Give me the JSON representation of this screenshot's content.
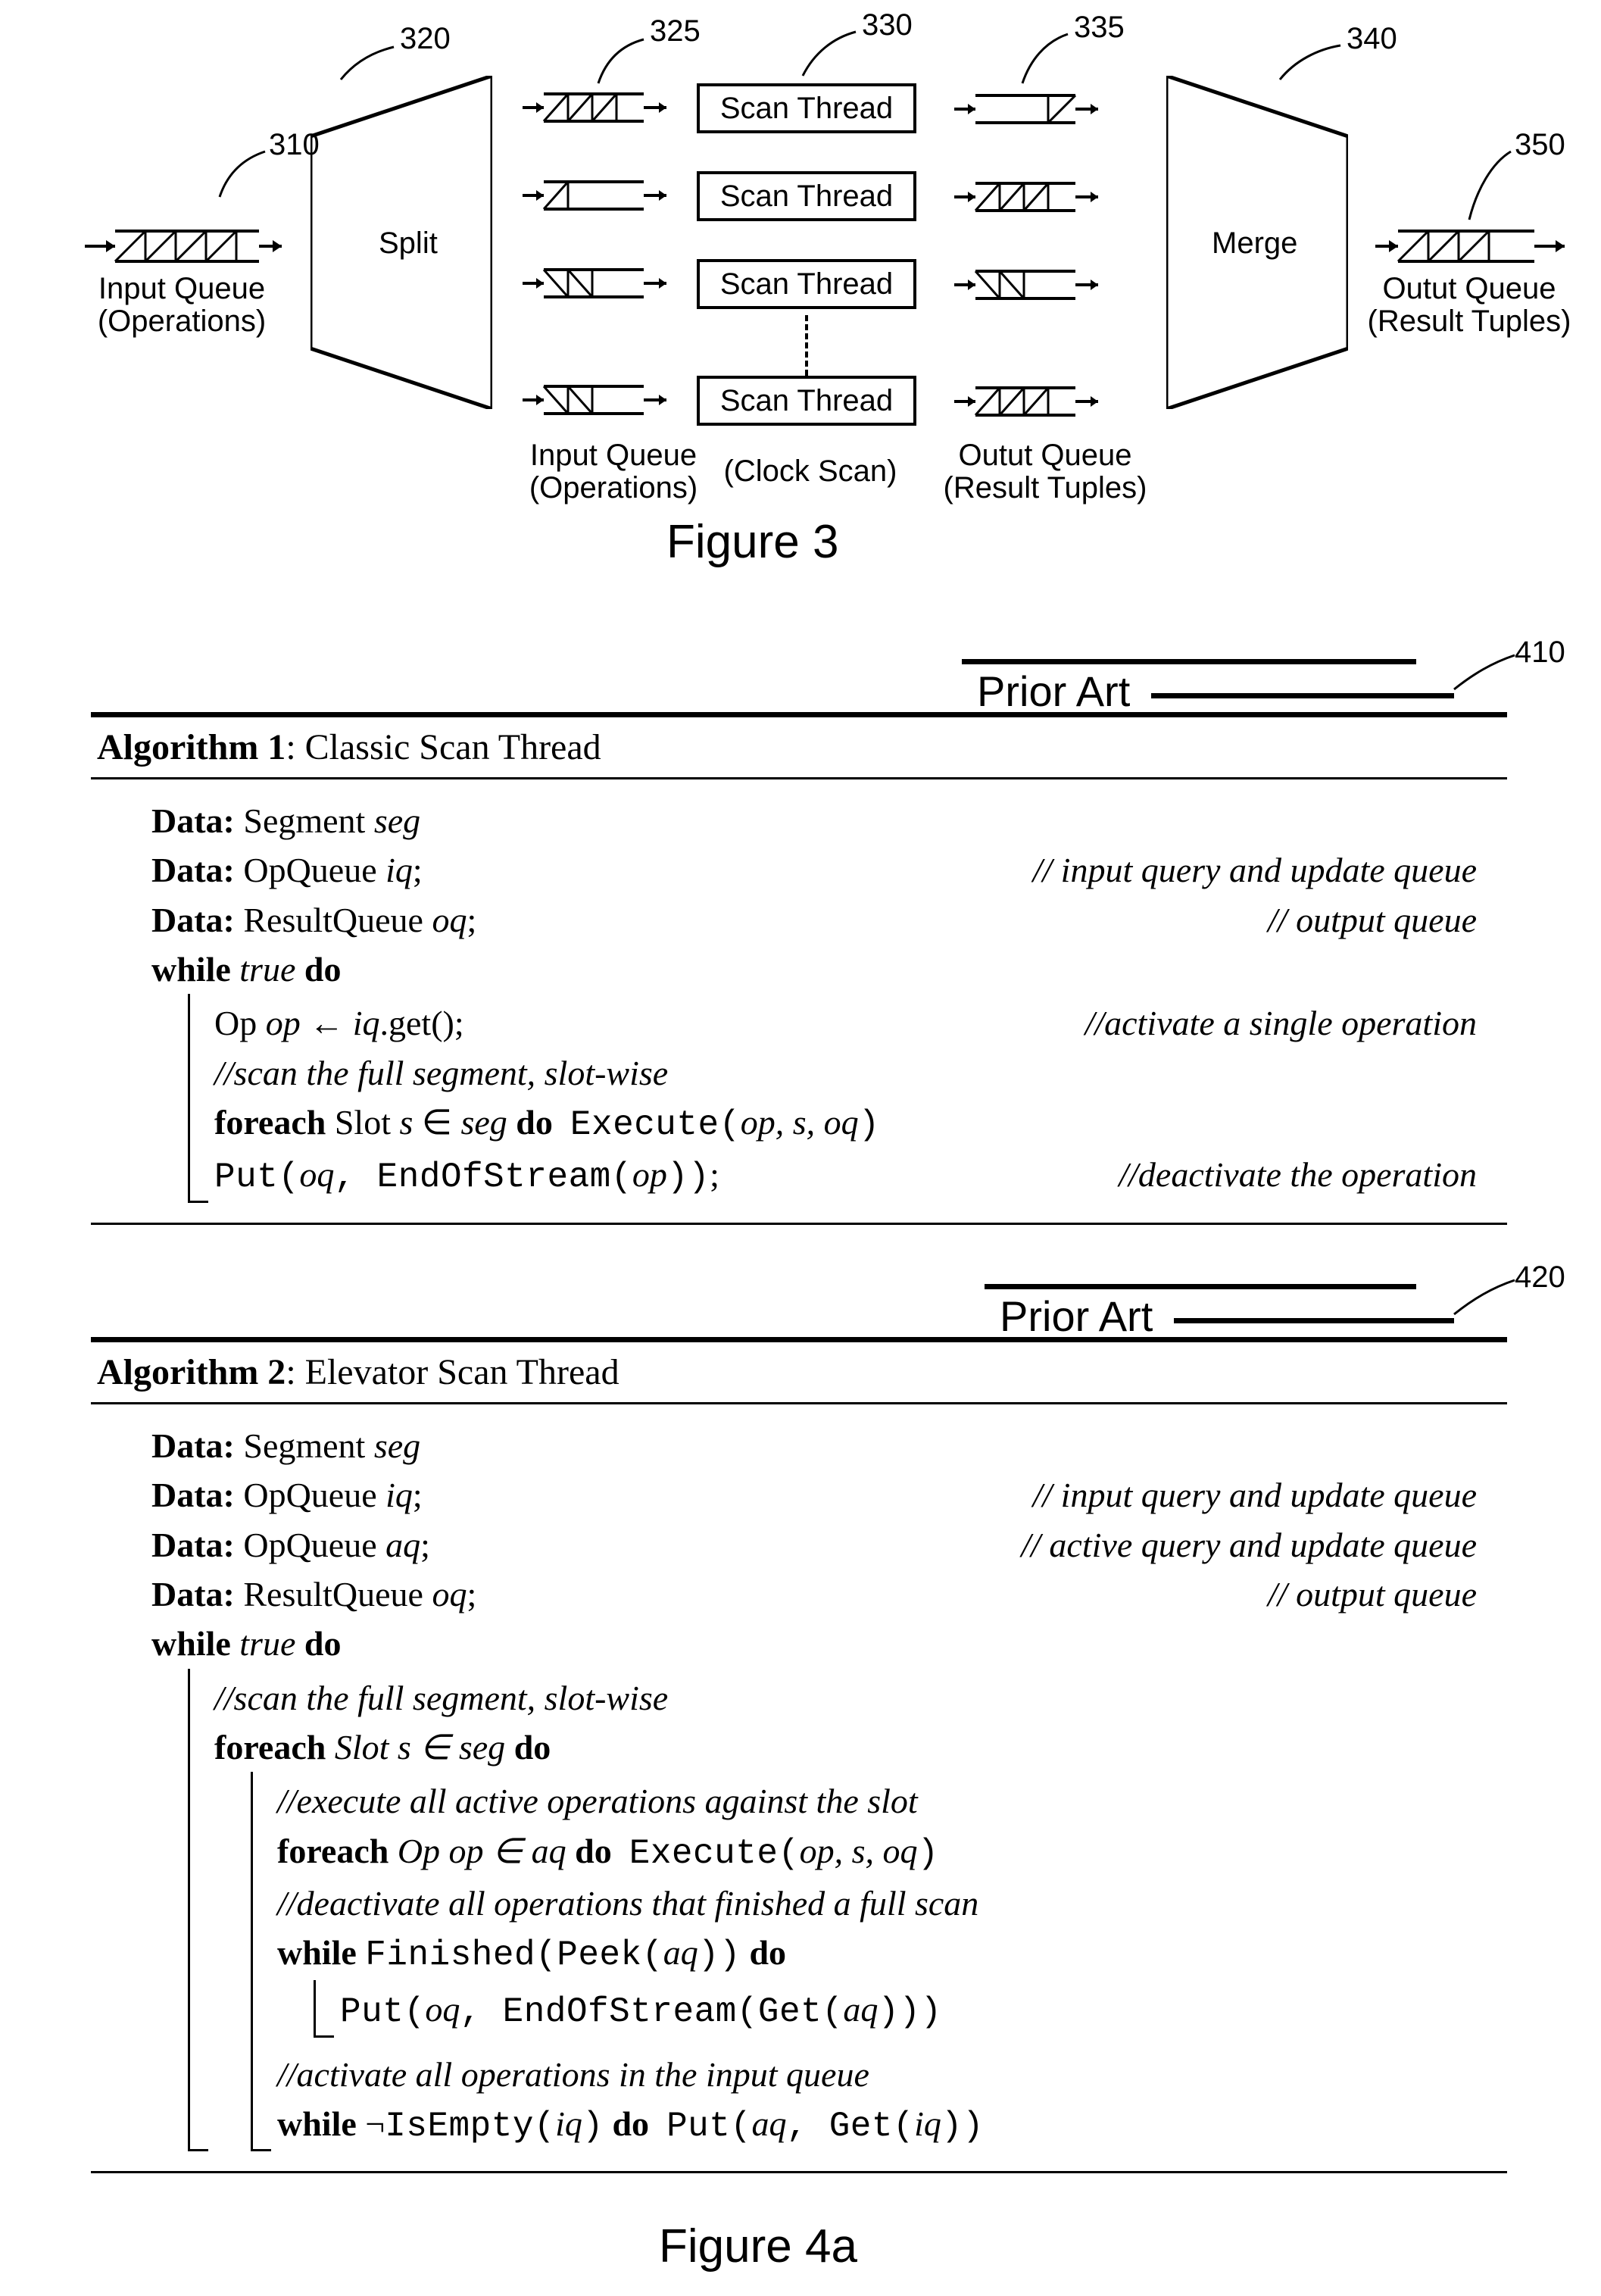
{
  "fig3": {
    "refs": {
      "r310": "310",
      "r320": "320",
      "r325": "325",
      "r330": "330",
      "r335": "335",
      "r340": "340",
      "r350": "350"
    },
    "split": "Split",
    "merge": "Merge",
    "scan_thread": "Scan Thread",
    "input_queue_l1": "Input Queue",
    "input_queue_l2": "(Operations)",
    "clock_scan": "(Clock Scan)",
    "output_queue_l1": "Outut Queue",
    "output_queue_l2": "(Result Tuples)",
    "caption": "Figure 3"
  },
  "prior_art": "Prior Art",
  "algo1": {
    "ref": "410",
    "title_bold": "Algorithm 1",
    "title_rest": ": Classic Scan Thread",
    "l_data": "Data:",
    "l_seg": " Segment ",
    "v_seg": "seg",
    "l_opq": " OpQueue ",
    "v_iq": "iq",
    "sc": ";",
    "c_iq": "// input query and update queue",
    "l_res": " ResultQueue ",
    "v_oq": "oq",
    "c_oq": "// output queue",
    "l_while": "while",
    "v_true": " true ",
    "l_do": "do",
    "l_op": "Op ",
    "v_op": "op",
    "l_arrow": " ← ",
    "v_iqget": "iq",
    "l_get": ".get();",
    "c_act": "//activate a single operation",
    "c_scan": "//scan the full segment, slot-wise",
    "l_foreach": "foreach",
    "l_slot": " Slot ",
    "v_s": "s",
    "l_in": " ∈ ",
    "v_seg2": "seg ",
    "l_exec": "Execute(",
    "v_ops": "op, s, oq",
    "l_cp": ")",
    "l_put": "Put(",
    "v_oqc": "oq",
    "l_cm": ", ",
    "l_eos": "EndOfStream(",
    "v_opc": "op",
    "l_cpp": "))",
    "c_deact": "//deactivate the operation"
  },
  "algo2": {
    "ref": "420",
    "title_bold": "Algorithm 2",
    "title_rest": ": Elevator Scan Thread",
    "l_data": "Data:",
    "l_seg": " Segment ",
    "v_seg": "seg",
    "l_opq": " OpQueue ",
    "v_iq": "iq",
    "sc": ";",
    "c_iq": "// input query and update queue",
    "v_aq": "aq",
    "c_aq": "// active query and update queue",
    "l_res": " ResultQueue ",
    "v_oq": "oq",
    "c_oq": "// output queue",
    "l_while": "while",
    "v_true": " true ",
    "l_do": "do",
    "c_scan": "//scan the full segment, slot-wise",
    "l_foreach": "foreach",
    "v_slot": " Slot s ∈ seg ",
    "c_exec_all": "//execute all active operations against the slot",
    "v_opaq": " Op op ∈ aq ",
    "l_exec": "Execute(",
    "v_ops": "op, s, oq",
    "l_cp": ")",
    "c_deact_full": "//deactivate all operations that finished a full scan",
    "l_fin": "Finished(Peek(",
    "v_aqc": "aq",
    "l_cpp": "))",
    "l_put": "Put(",
    "v_oqc": "oq",
    "l_cm": ", ",
    "l_eos": "EndOfStream(Get(",
    "l_cppp": ")))",
    "c_act_input": "//activate all operations in the input queue",
    "l_not": "¬",
    "l_isempty": "IsEmpty(",
    "v_iqc": "iq",
    "l_get": "Get(",
    "caption": "Figure 4a"
  }
}
